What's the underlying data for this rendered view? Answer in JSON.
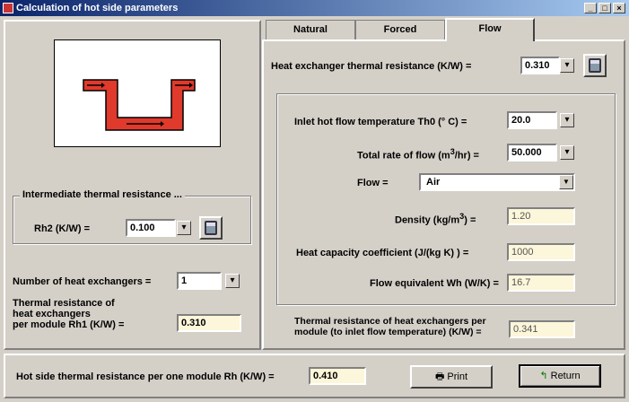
{
  "window": {
    "title": "Calculation of hot side parameters",
    "minimize": "_",
    "maximize": "□",
    "close": "×"
  },
  "tabs": [
    {
      "label": "Natural"
    },
    {
      "label": "Forced"
    },
    {
      "label": "Flow"
    }
  ],
  "left": {
    "group_title": "Intermediate thermal resistance ...",
    "rh2_label": "Rh2 (K/W) =",
    "rh2_value": "0.100",
    "num_label": "Number of heat exchangers =",
    "num_value": "1",
    "res_label_1": "Thermal resistance of",
    "res_label_2": "heat exchangers",
    "res_label_3": "per module Rh1 (K/W) =",
    "res_value": "0.310"
  },
  "flow": {
    "hx_label": "Heat exchanger thermal resistance (K/W) =",
    "hx_value": "0.310",
    "inlet_label": "Inlet hot flow temperature Th0 (° C) =",
    "inlet_value": "20.0",
    "total_label_a": "Total rate of flow (m",
    "total_label_sup": "3",
    "total_label_b": "/hr) =",
    "total_value": "50.000",
    "flow_label": "Flow =",
    "flow_value": "Air",
    "density_label_a": "Density (kg/m",
    "density_label_sup": "3",
    "density_label_b": ") =",
    "density_value": "1.20",
    "heatcap_label": "Heat capacity coefficient (J/(kg K) ) =",
    "heatcap_value": "1000",
    "equiv_label": "Flow equivalent  Wh (W/K) =",
    "equiv_value": "16.7",
    "thermal_label_1": "Thermal resistance of heat exchangers per",
    "thermal_label_2": "module  (to inlet flow temperature) (K/W) =",
    "thermal_value": "0.341"
  },
  "bottom": {
    "hot_label": "Hot side thermal resistance per one module Rh (K/W) =",
    "hot_value": "0.410",
    "print_label": "Print",
    "return_label": "Return"
  },
  "colors": {
    "exchanger_red": "#e03a2c",
    "readonly_bg": "#fcf6da",
    "titlebar": "#0a246a"
  }
}
